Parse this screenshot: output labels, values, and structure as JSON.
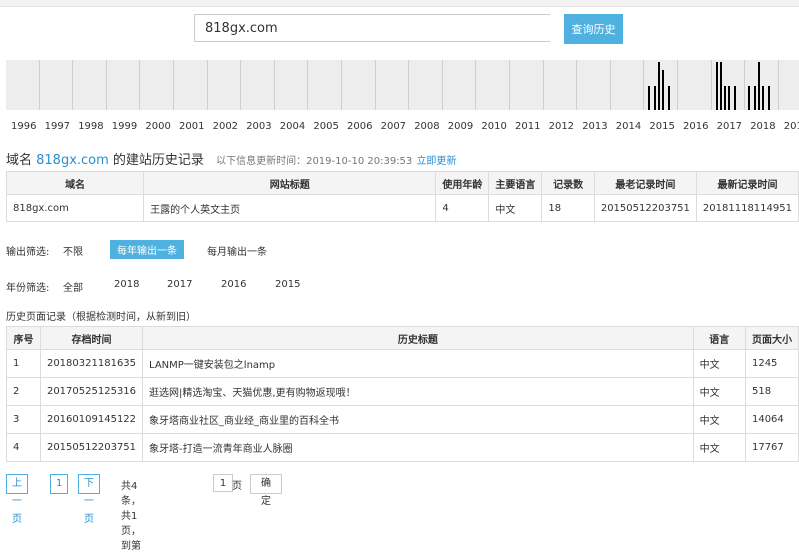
{
  "search": {
    "value": "818gx.com",
    "button_label": "查询历史"
  },
  "timeline": {
    "years": [
      "1996",
      "1997",
      "1998",
      "1999",
      "2000",
      "2001",
      "2002",
      "2003",
      "2004",
      "2005",
      "2006",
      "2007",
      "2008",
      "2009",
      "2010",
      "2011",
      "2012",
      "2013",
      "2014",
      "2015",
      "2016",
      "2017",
      "2018",
      "201"
    ]
  },
  "title": {
    "prefix": "域名 ",
    "domain": "818gx.com",
    "suffix": " 的建站历史记录",
    "note": "以下信息更新时间：2019-10-10 20:39:53",
    "update_link": "立即更新"
  },
  "summary": {
    "headers": [
      "域名",
      "网站标题",
      "使用年龄",
      "主要语言",
      "记录数",
      "最老记录时间",
      "最新记录时间"
    ],
    "row": [
      "818gx.com",
      "王露的个人英文主页",
      "4",
      "中文",
      "18",
      "20150512203751",
      "20181118114951"
    ]
  },
  "output_filter": {
    "label": "输出筛选:",
    "options": [
      "不限",
      "每年输出一条",
      "每月输出一条"
    ]
  },
  "year_filter": {
    "label": "年份筛选:",
    "options": [
      "全部",
      "2018",
      "2017",
      "2016",
      "2015"
    ]
  },
  "history_note": "历史页面记录（根据检测时间，从新到旧）",
  "history": {
    "headers": [
      "序号",
      "存档时间",
      "历史标题",
      "语言",
      "页面大小"
    ],
    "rows": [
      [
        "1",
        "20180321181635",
        "LANMP一键安装包之lnamp",
        "中文",
        "1245"
      ],
      [
        "2",
        "20170525125316",
        "逛选网|精选淘宝、天猫优惠,更有购物返现哦！",
        "中文",
        "518"
      ],
      [
        "3",
        "20160109145122",
        "象牙塔商业社区_商业经_商业里的百科全书",
        "中文",
        "14064"
      ],
      [
        "4",
        "20150512203751",
        "象牙塔-打造一流青年商业人脉圈",
        "中文",
        "17767"
      ]
    ]
  },
  "pager": {
    "prev": "上一页",
    "page": "1",
    "next": "下一页",
    "summary": "共4条，共1页，到第",
    "goto_value": "1",
    "page_unit": "页",
    "ok": "确定"
  }
}
